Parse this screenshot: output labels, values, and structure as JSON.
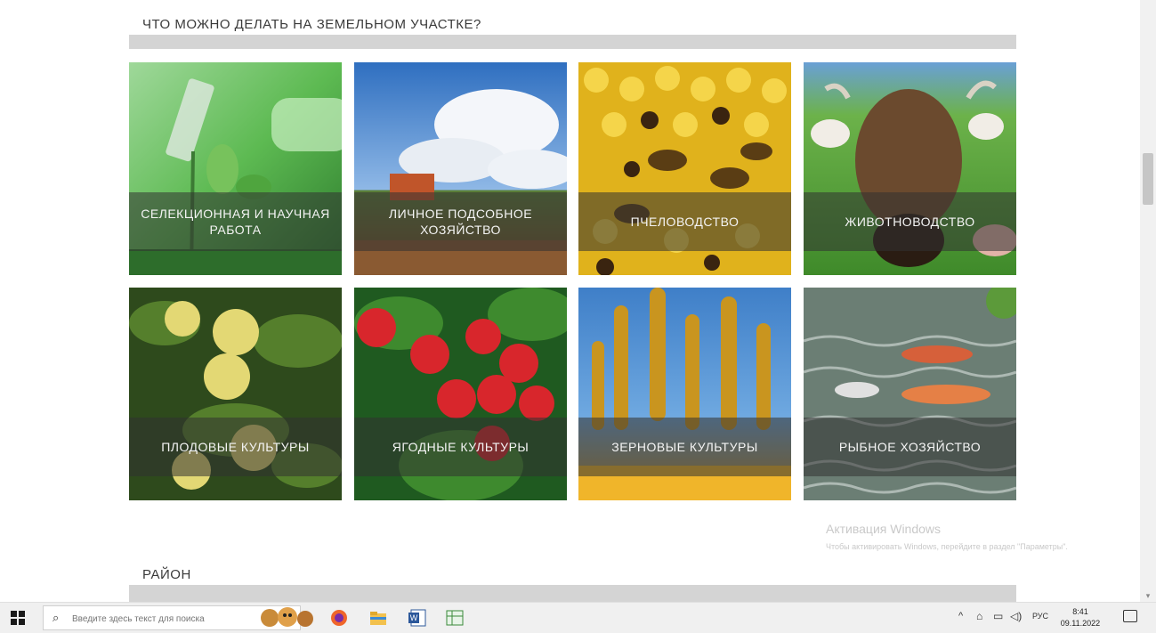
{
  "sections": {
    "what_to_do_title": "ЧТО МОЖНО ДЕЛАТЬ НА ЗЕМЕЛЬНОМ УЧАСТКЕ?",
    "district_title": "РАЙОН"
  },
  "tiles": [
    {
      "label": "СЕЛЕКЦИОННАЯ И НАУЧНАЯ РАБОТА",
      "image": "lab-seedling"
    },
    {
      "label": "ЛИЧНОЕ ПОДСОБНОЕ ХОЗЯЙСТВО",
      "image": "tractor-field"
    },
    {
      "label": "ПЧЕЛОВОДСТВО",
      "image": "bees-honeycomb"
    },
    {
      "label": "ЖИВОТНОВОДСТВО",
      "image": "cow"
    },
    {
      "label": "ПЛОДОВЫЕ КУЛЬТУРЫ",
      "image": "apples"
    },
    {
      "label": "ЯГОДНЫЕ КУЛЬТУРЫ",
      "image": "strawberries"
    },
    {
      "label": "ЗЕРНОВЫЕ КУЛЬТУРЫ",
      "image": "wheat"
    },
    {
      "label": "РЫБНОЕ ХОЗЯЙСТВО",
      "image": "koi-fish"
    }
  ],
  "watermark": {
    "title": "Активация Windows",
    "text": "Чтобы активировать Windows, перейдите в раздел \"Параметры\"."
  },
  "taskbar": {
    "search_placeholder": "Введите здесь текст для поиска",
    "language": "РУС",
    "time": "8:41",
    "date": "09.11.2022"
  },
  "colors": {
    "section_bar": "#d4d4d4",
    "band": "rgba(50,50,50,0.55)",
    "taskbar": "#f0f0f0"
  }
}
